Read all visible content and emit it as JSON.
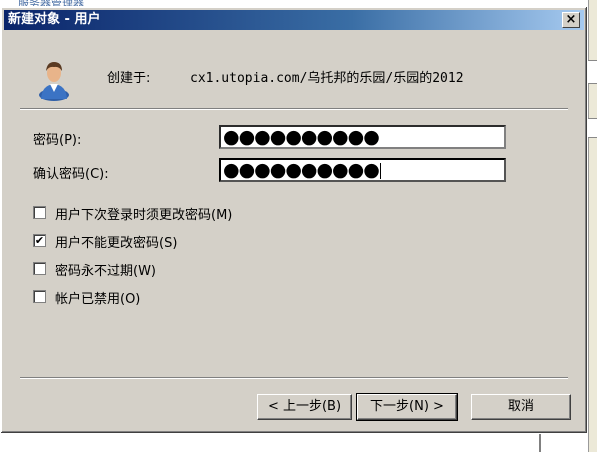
{
  "background": {
    "title_ghost": "服务器管理器"
  },
  "dialog": {
    "title": "新建对象 - 用户",
    "close_glyph": "×",
    "created_in_label": "创建于:",
    "created_in_path": "cx1.utopia.com/乌托邦的乐园/乐园的2012"
  },
  "fields": {
    "password_label": "密码(P):",
    "password_value": "●●●●●●●●●●",
    "confirm_label": "确认密码(C):",
    "confirm_value": "●●●●●●●●●●"
  },
  "options": [
    {
      "label": "用户下次登录时须更改密码(M)",
      "checked": false
    },
    {
      "label": "用户不能更改密码(S)",
      "checked": true
    },
    {
      "label": "密码永不过期(W)",
      "checked": false
    },
    {
      "label": "帐户已禁用(O)",
      "checked": false
    }
  ],
  "buttons": {
    "back": "< 上一步(B)",
    "next": "下一步(N) >",
    "cancel": "取消"
  },
  "icons": {
    "user": "user-icon",
    "close": "close-icon",
    "check": "✔"
  }
}
